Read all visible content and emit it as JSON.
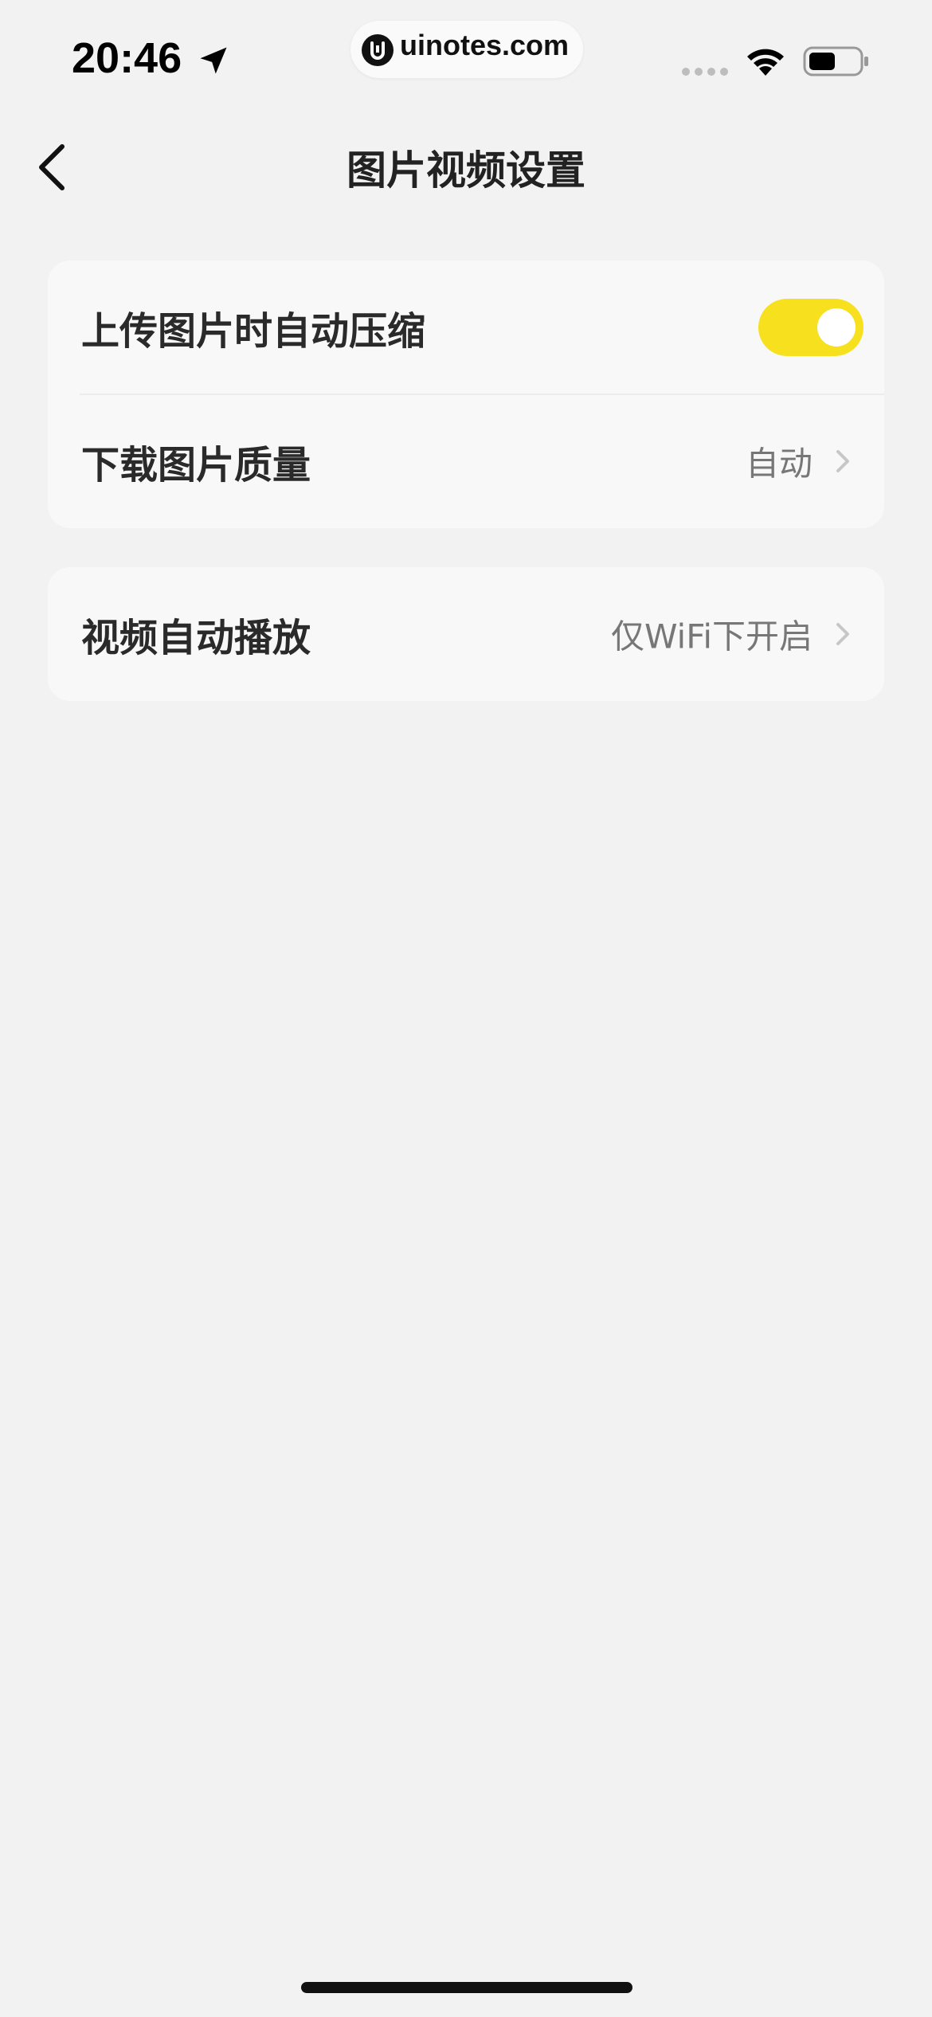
{
  "status_bar": {
    "time": "20:46",
    "watermark": "uinotes.com"
  },
  "nav": {
    "title": "图片视频设置"
  },
  "settings": {
    "auto_compress": {
      "label": "上传图片时自动压缩",
      "enabled": true
    },
    "download_quality": {
      "label": "下载图片质量",
      "value": "自动"
    },
    "video_autoplay": {
      "label": "视频自动播放",
      "value": "仅WiFi下开启"
    }
  },
  "colors": {
    "toggle_on": "#f7e01e",
    "background": "#f2f2f2",
    "card": "#f8f8f8"
  }
}
